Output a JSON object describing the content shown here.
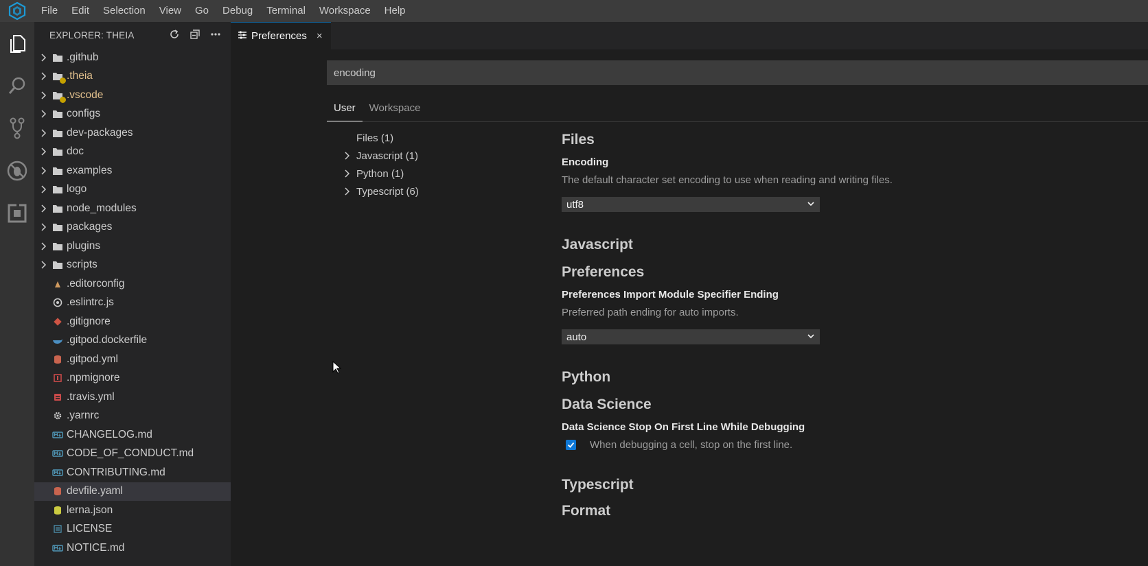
{
  "menu": {
    "items": [
      "File",
      "Edit",
      "Selection",
      "View",
      "Go",
      "Debug",
      "Terminal",
      "Workspace",
      "Help"
    ]
  },
  "activity": {
    "icons": [
      "files-icon",
      "search-icon",
      "source-control-icon",
      "debug-icon",
      "extensions-icon"
    ]
  },
  "explorer": {
    "title": "EXPLORER: THEIA",
    "items": [
      {
        "name": ".github",
        "type": "folder"
      },
      {
        "name": ".theia",
        "type": "folder",
        "modified": true
      },
      {
        "name": ".vscode",
        "type": "folder",
        "modified": true
      },
      {
        "name": "configs",
        "type": "folder"
      },
      {
        "name": "dev-packages",
        "type": "folder"
      },
      {
        "name": "doc",
        "type": "folder"
      },
      {
        "name": "examples",
        "type": "folder"
      },
      {
        "name": "logo",
        "type": "folder"
      },
      {
        "name": "node_modules",
        "type": "folder"
      },
      {
        "name": "packages",
        "type": "folder"
      },
      {
        "name": "plugins",
        "type": "folder"
      },
      {
        "name": "scripts",
        "type": "folder"
      },
      {
        "name": ".editorconfig",
        "type": "file",
        "icon": "editorconfig-icon"
      },
      {
        "name": ".eslintrc.js",
        "type": "file",
        "icon": "eslint-icon"
      },
      {
        "name": ".gitignore",
        "type": "file",
        "icon": "git-icon"
      },
      {
        "name": ".gitpod.dockerfile",
        "type": "file",
        "icon": "docker-icon"
      },
      {
        "name": ".gitpod.yml",
        "type": "file",
        "icon": "yaml-icon"
      },
      {
        "name": ".npmignore",
        "type": "file",
        "icon": "npm-icon"
      },
      {
        "name": ".travis.yml",
        "type": "file",
        "icon": "travis-icon"
      },
      {
        "name": ".yarnrc",
        "type": "file",
        "icon": "settings-icon"
      },
      {
        "name": "CHANGELOG.md",
        "type": "file",
        "icon": "markdown-icon"
      },
      {
        "name": "CODE_OF_CONDUCT.md",
        "type": "file",
        "icon": "markdown-icon"
      },
      {
        "name": "CONTRIBUTING.md",
        "type": "file",
        "icon": "markdown-icon"
      },
      {
        "name": "devfile.yaml",
        "type": "file",
        "icon": "yaml-icon",
        "selected": true
      },
      {
        "name": "lerna.json",
        "type": "file",
        "icon": "json-icon"
      },
      {
        "name": "LICENSE",
        "type": "file",
        "icon": "license-icon"
      },
      {
        "name": "NOTICE.md",
        "type": "file",
        "icon": "markdown-icon"
      }
    ]
  },
  "editor": {
    "tab_label": "Preferences",
    "tab_close": "×",
    "search_value": "encoding",
    "scope_tabs": [
      "User",
      "Workspace"
    ],
    "tree": [
      {
        "label": "Files (1)",
        "expandable": false
      },
      {
        "label": "Javascript (1)",
        "expandable": true
      },
      {
        "label": "Python (1)",
        "expandable": true
      },
      {
        "label": "Typescript (6)",
        "expandable": true
      }
    ],
    "files_header": "Files",
    "encoding_name": "Encoding",
    "encoding_desc": "The default character set encoding to use when reading and writing files.",
    "encoding_value": "utf8",
    "javascript_header": "Javascript",
    "js_pref_header": "Preferences",
    "js_pref_name": "Preferences Import Module Specifier Ending",
    "js_pref_desc": "Preferred path ending for auto imports.",
    "js_pref_value": "auto",
    "python_header": "Python",
    "ds_header": "Data Science",
    "ds_name": "Data Science Stop On First Line While Debugging",
    "ds_desc": "When debugging a cell, stop on the first line.",
    "ds_checked": true,
    "typescript_header": "Typescript",
    "format_header": "Format"
  },
  "colors": {
    "accent": "#0e78d7",
    "git_modified": "#e2c08d"
  }
}
